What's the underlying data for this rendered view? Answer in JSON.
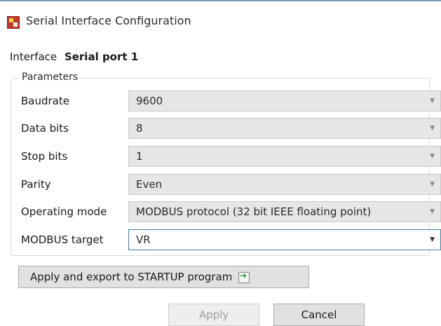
{
  "window": {
    "title": "Serial Interface Configuration",
    "icon": "app-config-icon"
  },
  "interface": {
    "label": "Interface",
    "value": "Serial port 1"
  },
  "parameters": {
    "legend": "Parameters",
    "rows": [
      {
        "label": "Baudrate",
        "value": "9600",
        "enabled": false
      },
      {
        "label": "Data bits",
        "value": "8",
        "enabled": true
      },
      {
        "label": "Stop bits",
        "value": "1",
        "enabled": true
      },
      {
        "label": "Parity",
        "value": "Even",
        "enabled": true
      },
      {
        "label": "Operating mode",
        "value": "MODBUS protocol (32 bit IEEE floating point)",
        "enabled": false
      },
      {
        "label": "MODBUS target",
        "value": "VR",
        "enabled": true,
        "focused": true
      }
    ]
  },
  "buttons": {
    "export_label": "Apply and export to STARTUP program",
    "export_icon": "export-arrow-icon",
    "apply_label": "Apply",
    "apply_enabled": false,
    "cancel_label": "Cancel"
  },
  "colors": {
    "focus_border": "#3c7fb1",
    "export_arrow": "#2e9e3a",
    "disabled_text": "#a0a0a0"
  }
}
